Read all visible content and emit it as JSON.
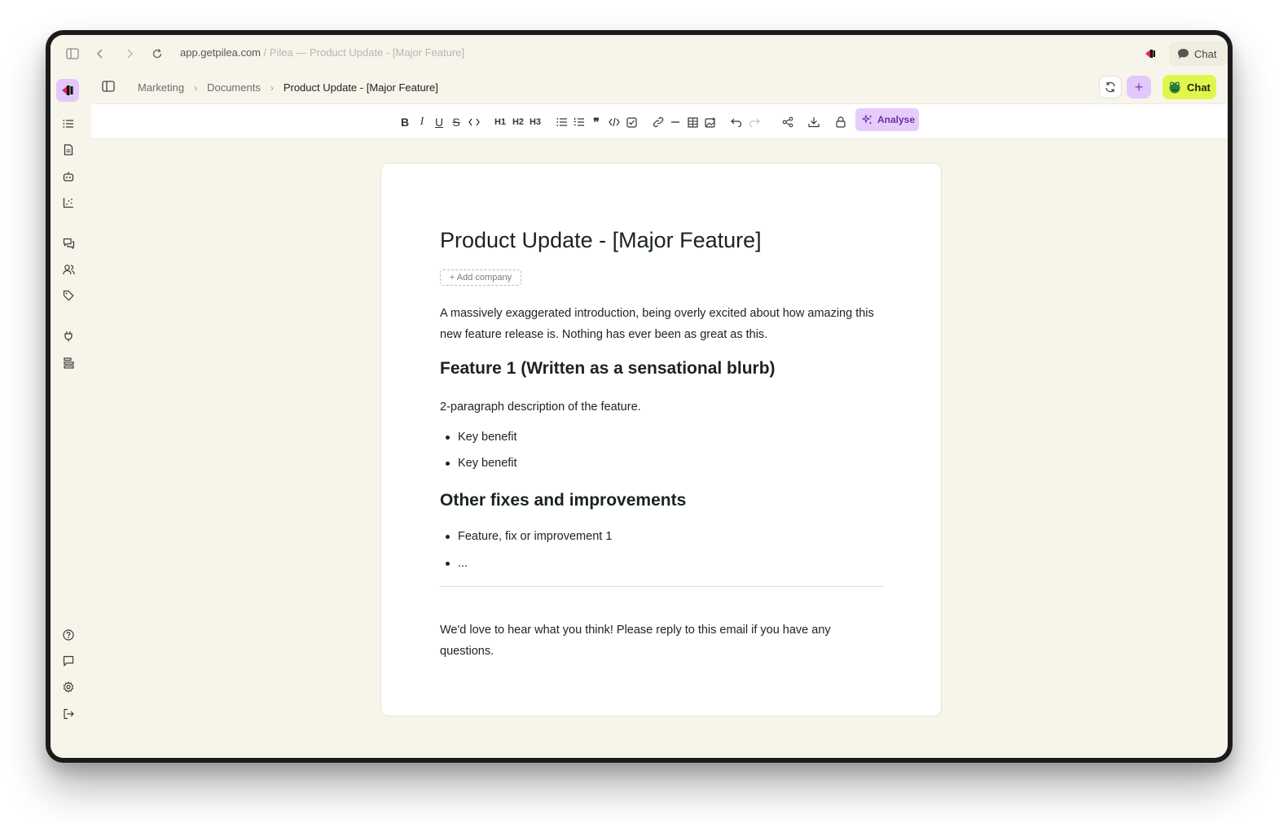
{
  "browser": {
    "url_domain": "app.getpilea.com",
    "url_separator": " / ",
    "url_title": "Pilea — Product Update - [Major Feature]",
    "chat_label": "Chat"
  },
  "breadcrumb": {
    "items": [
      "Marketing",
      "Documents"
    ],
    "current": "Product Update - [Major Feature]"
  },
  "header": {
    "chat_label": "Chat",
    "plus_label": "+"
  },
  "toolbar": {
    "h1": "H1",
    "h2": "H2",
    "h3": "H3",
    "analyse_label": "Analyse"
  },
  "document": {
    "title": "Product Update - [Major Feature]",
    "add_company": "+ Add company",
    "intro": "A massively exaggerated introduction, being overly excited about how amazing this new feature release is. Nothing has ever been as great as this.",
    "feature_heading": "Feature 1 (Written as a sensational blurb)",
    "feature_desc": "2-paragraph description of the feature.",
    "feature_bullets": [
      "Key benefit",
      "Key benefit"
    ],
    "other_heading": "Other fixes and improvements",
    "other_bullets": [
      "Feature, fix or improvement 1",
      "..."
    ],
    "closing": "We'd love to hear what you think! Please reply to this email if you have any questions."
  },
  "colors": {
    "background": "#f7f5ea",
    "accent_purple": "#e3c8fb",
    "accent_lime": "#e0f64b"
  }
}
